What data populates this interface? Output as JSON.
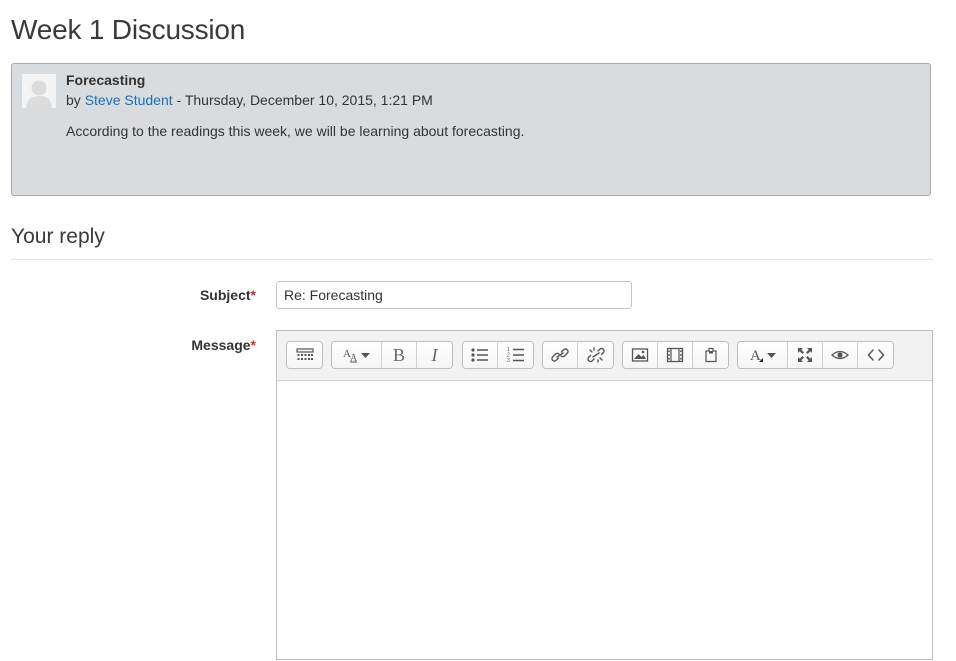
{
  "page": {
    "title": "Week 1 Discussion"
  },
  "post": {
    "subject": "Forecasting",
    "by_prefix": "by",
    "author": "Steve Student",
    "date_separator": " - ",
    "date": "Thursday, December 10, 2015, 1:21 PM",
    "message": "According to the readings this week, we will be learning about forecasting."
  },
  "reply": {
    "heading": "Your reply",
    "subject_label": "Subject",
    "message_label": "Message",
    "required_mark": "*",
    "subject_value": "Re: Forecasting"
  },
  "toolbar": {
    "groups": [
      [
        "show-more-buttons-icon"
      ],
      [
        "font-style-icon",
        "bold-icon",
        "italic-icon"
      ],
      [
        "unordered-list-icon",
        "ordered-list-icon"
      ],
      [
        "link-icon",
        "unlink-icon"
      ],
      [
        "image-icon",
        "media-icon",
        "manage-files-icon"
      ],
      [
        "font-color-icon",
        "fullscreen-icon",
        "preview-icon",
        "html-icon"
      ]
    ],
    "bold_glyph": "B",
    "italic_glyph": "I"
  },
  "colors": {
    "link": "#1a6fb6",
    "required": "#d9262c",
    "post_background": "#d9dcdf"
  }
}
